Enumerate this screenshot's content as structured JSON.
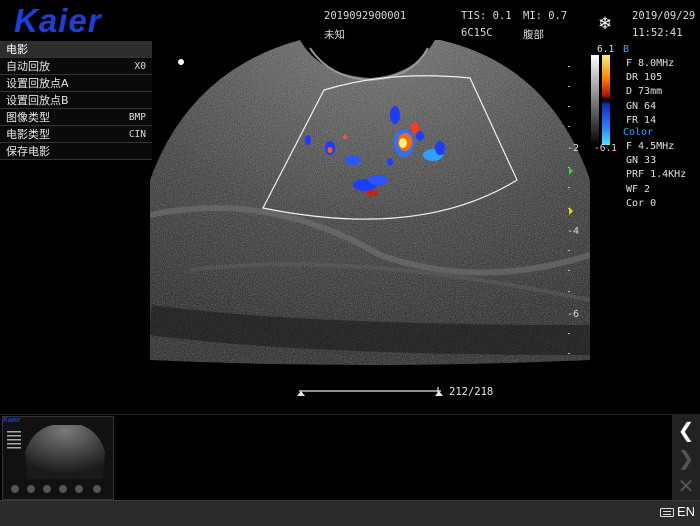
{
  "header": {
    "logo": "Kaier",
    "patient_id": "2019092900001",
    "patient_name": "未知",
    "tis": "TIS: 0.1",
    "mi": "MI: 0.7",
    "probe": "6C15C",
    "exam": "腹部",
    "date": "2019/09/29",
    "time": "11:52:41",
    "freeze_icon": "snowflake-icon"
  },
  "menu": {
    "title": "电影",
    "items": [
      {
        "label": "自动回放",
        "value": "X0"
      },
      {
        "label": "设置回放点A",
        "value": ""
      },
      {
        "label": "设置回放点B",
        "value": ""
      },
      {
        "label": "图像类型",
        "value": "BMP"
      },
      {
        "label": "电影类型",
        "value": "CIN"
      },
      {
        "label": "保存电影",
        "value": ""
      }
    ]
  },
  "colorbar": {
    "top": "6.1",
    "bottom": "-6.1"
  },
  "bmode": {
    "label": "B",
    "lines": [
      "F   8.0MHz",
      "DR  105",
      "D   73mm",
      "GN  64",
      "FR  14"
    ]
  },
  "color": {
    "label": "Color",
    "lines": [
      "F   4.5MHz",
      "GN  33",
      "PRF 1.4KHz",
      "WF  2",
      "Cor 0"
    ]
  },
  "depth_scale": [
    "-2",
    "-4",
    "-6"
  ],
  "cine": {
    "frame": "212/218"
  },
  "status": {
    "lang": "EN",
    "keyboard_icon": "keyboard-icon"
  },
  "sidebar": {
    "up_icon": "chevron-left-icon",
    "next_icon": "chevron-right-icon",
    "close_icon": "close-icon"
  },
  "colors": {
    "logo": "#1c3fd8",
    "accent": "#2aa9ff"
  }
}
